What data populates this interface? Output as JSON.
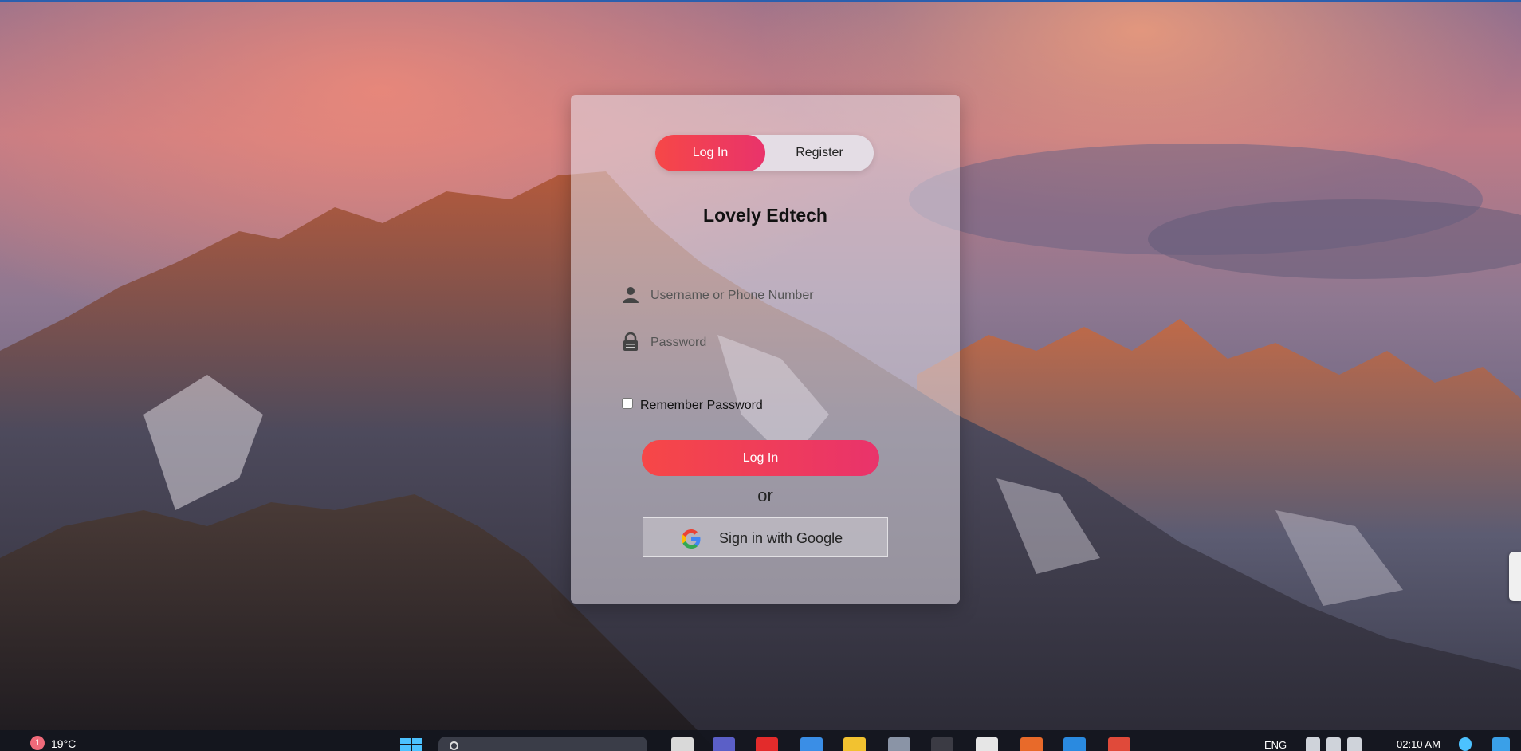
{
  "auth": {
    "tabs": {
      "login_label": "Log In",
      "register_label": "Register"
    },
    "brand_title": "Lovely Edtech",
    "username": {
      "placeholder": "Username or Phone Number",
      "value": ""
    },
    "password": {
      "placeholder": "Password",
      "value": ""
    },
    "remember_label": "Remember Password",
    "submit_label": "Log In",
    "separator_text": "or",
    "google_label": "Sign in with Google"
  },
  "taskbar": {
    "weather_alert_count": "1",
    "temperature": "19°C",
    "language": "ENG",
    "clock_time": "02:10 AM"
  },
  "colors": {
    "accent_start": "#f64747",
    "accent_end": "#e9336b",
    "taskbar": "#14161e"
  },
  "icons": [
    "user-icon",
    "lock-icon",
    "google-icon",
    "windows-start-icon",
    "search-icon"
  ]
}
